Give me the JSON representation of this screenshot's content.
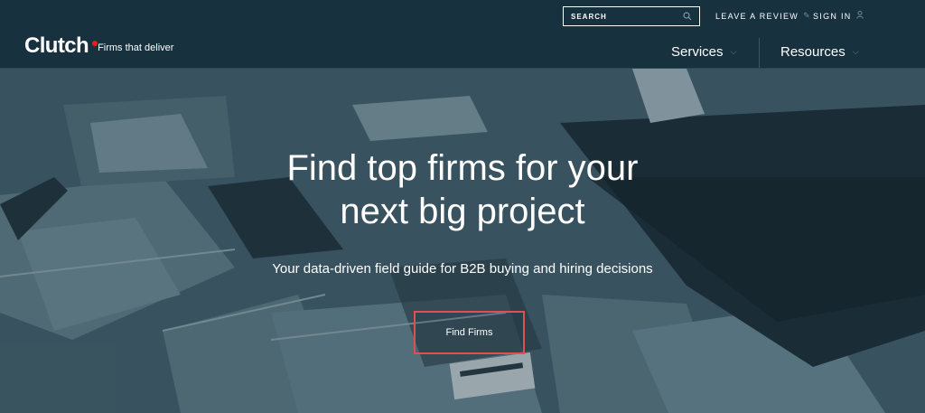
{
  "header": {
    "logo_text": "Clutch",
    "tagline": "Firms that deliver",
    "search_placeholder": "SEARCH",
    "leave_review": "LEAVE A REVIEW",
    "sign_in": "SIGN IN",
    "nav": [
      {
        "label": "Services"
      },
      {
        "label": "Resources"
      }
    ]
  },
  "hero": {
    "headline_line1": "Find top firms for your",
    "headline_line2": "next big project",
    "subheading": "Your data-driven field guide for B2B buying and hiring decisions",
    "cta_label": "Find Firms"
  },
  "colors": {
    "header_bg": "#17313e",
    "logo_dot": "#e62415",
    "cta_border": "#e05050"
  }
}
